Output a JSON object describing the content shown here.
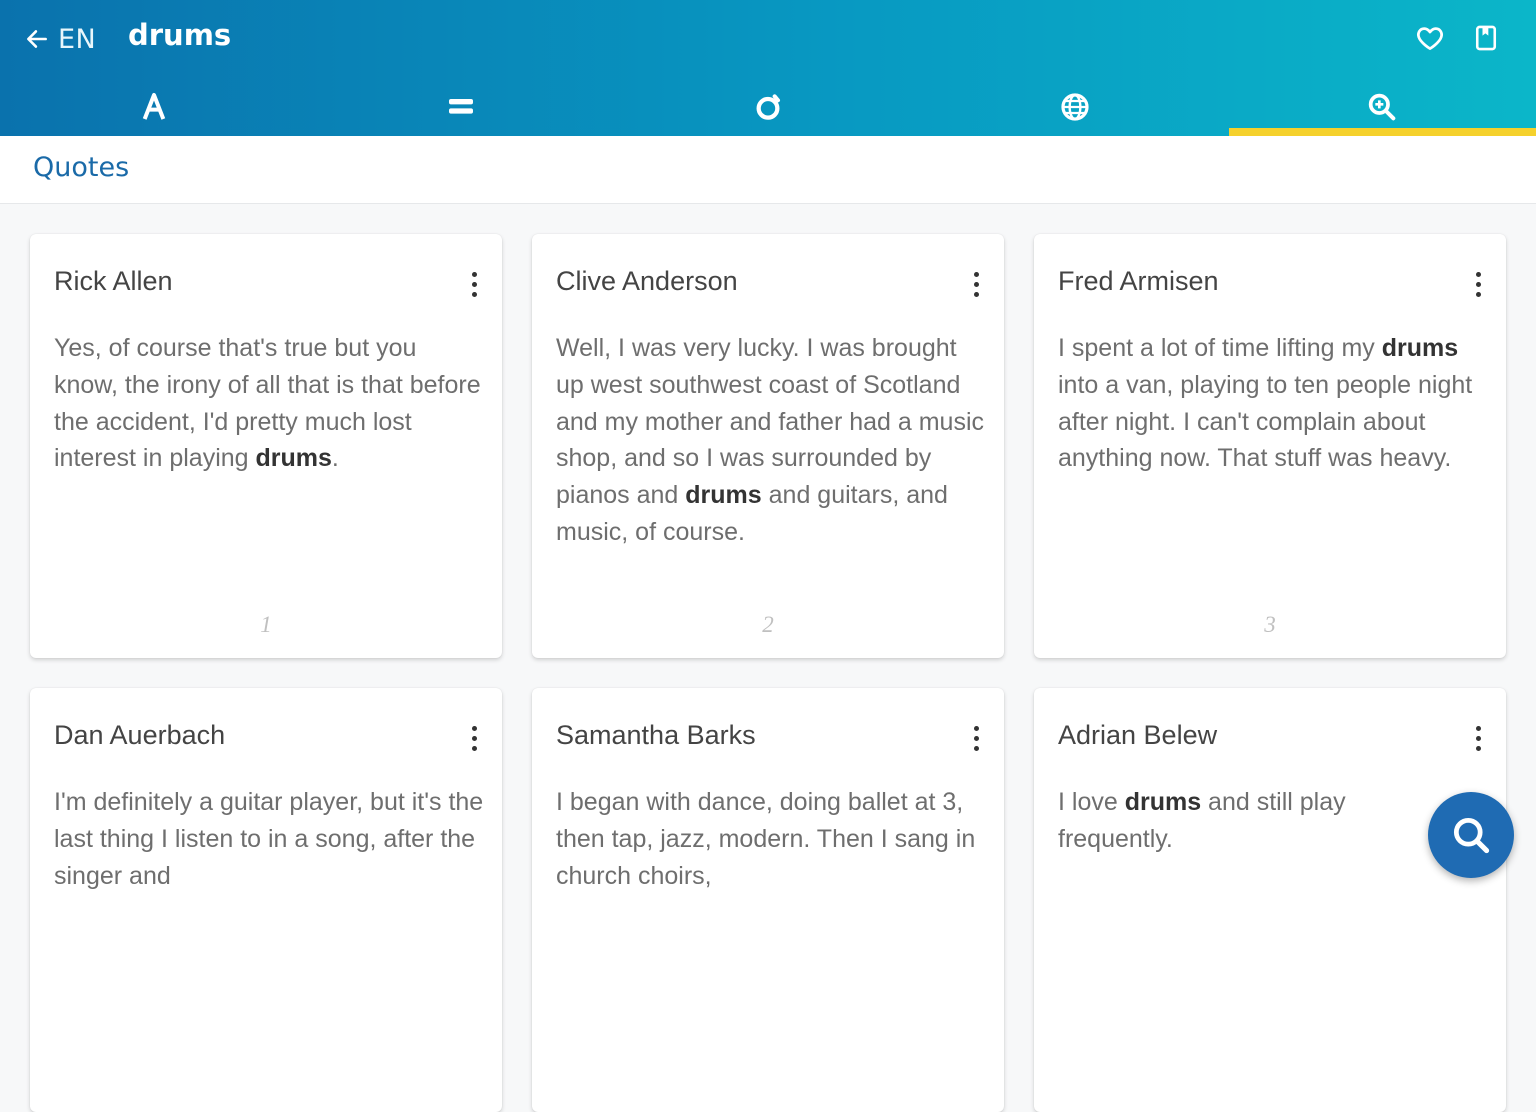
{
  "header": {
    "lang": "EN",
    "title": "drums",
    "icons": [
      "back-arrow-icon",
      "heart-icon",
      "bookmark-icon"
    ]
  },
  "tabs": [
    {
      "icon": "letter-a-icon",
      "active": false
    },
    {
      "icon": "list-icon",
      "active": false
    },
    {
      "icon": "topic-icon",
      "active": false
    },
    {
      "icon": "globe-icon",
      "active": false
    },
    {
      "icon": "search-icon",
      "active": true
    }
  ],
  "colors": {
    "accent": "#1a6aa8",
    "tab_indicator": "#f5d12c",
    "fab": "#1f6bb3"
  },
  "section": {
    "title": "Quotes"
  },
  "highlight": "drums",
  "cards": [
    {
      "author": "Rick Allen",
      "before": "Yes, of course that's true but you know, the irony of all that is that before the accident, I'd pretty much lost interest in playing ",
      "after": ".",
      "number": "1"
    },
    {
      "author": "Clive Anderson",
      "before": "Well, I was very lucky. I was brought up west southwest coast of Scotland and my mother and father had a music shop, and so I was surrounded by pianos and ",
      "after": " and guitars, and music, of course.",
      "number": "2"
    },
    {
      "author": "Fred Armisen",
      "before": "I spent a lot of time lifting my ",
      "after": " into a van, playing to ten people night after night. I can't complain about anything now. That stuff was heavy.",
      "number": "3"
    },
    {
      "author": "Dan Auerbach",
      "before": "I'm definitely a guitar player, but it's the last thing I listen to in a song, after the singer and",
      "after": "",
      "number": ""
    },
    {
      "author": "Samantha Barks",
      "before": "I began with dance, doing ballet at 3, then tap, jazz, modern. Then I sang in church choirs,",
      "after": "",
      "number": ""
    },
    {
      "author": "Adrian Belew",
      "before": "I love ",
      "after": " and still play frequently.",
      "number": ""
    }
  ]
}
